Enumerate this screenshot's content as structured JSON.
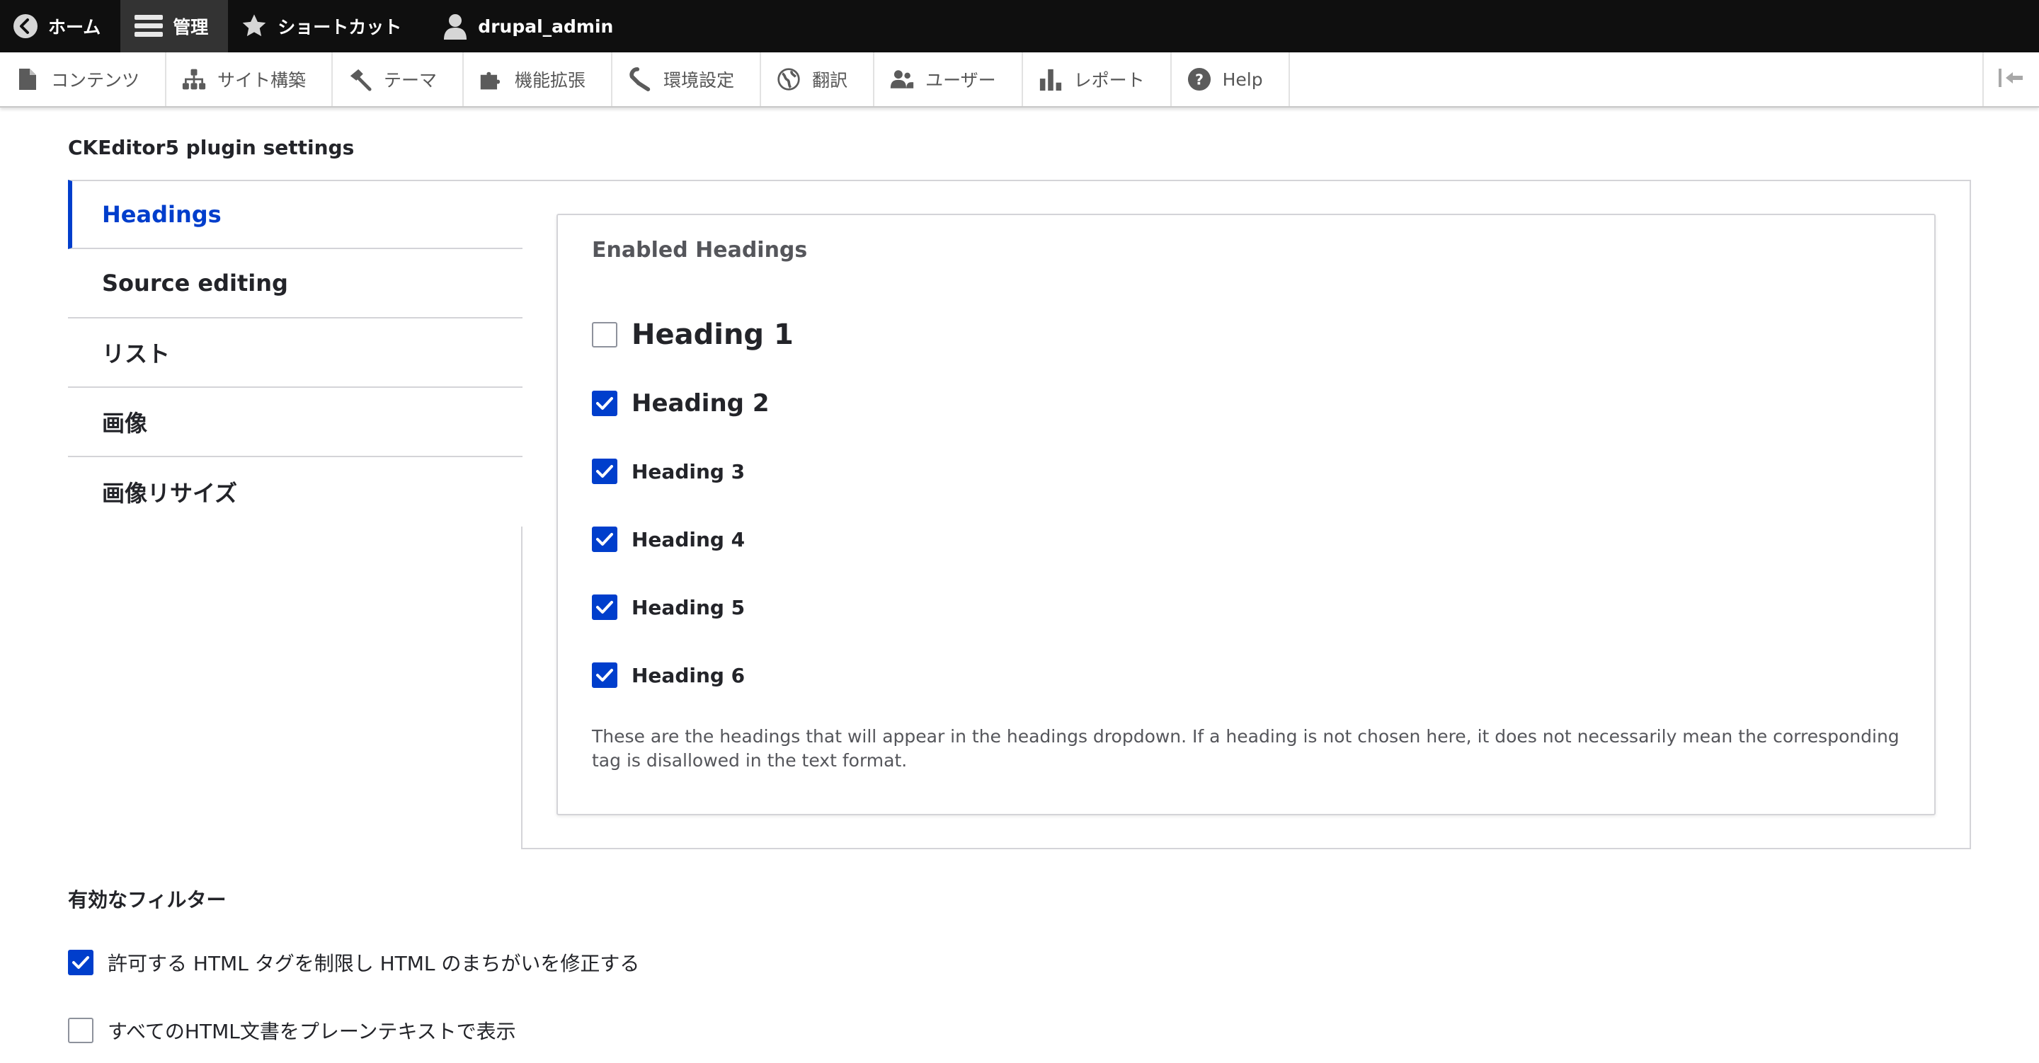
{
  "toolbar": {
    "home": "ホーム",
    "manage": "管理",
    "shortcuts": "ショートカット",
    "user": "drupal_admin"
  },
  "tray": {
    "items": [
      {
        "label": "コンテンツ",
        "icon": "file-icon"
      },
      {
        "label": "サイト構築",
        "icon": "sitemap-icon"
      },
      {
        "label": "テーマ",
        "icon": "paintbrush-icon"
      },
      {
        "label": "機能拡張",
        "icon": "puzzle-icon"
      },
      {
        "label": "環境設定",
        "icon": "wrench-icon"
      },
      {
        "label": "翻訳",
        "icon": "globe-icon"
      },
      {
        "label": "ユーザー",
        "icon": "people-icon"
      },
      {
        "label": "レポート",
        "icon": "bar-chart-icon"
      },
      {
        "label": "Help",
        "icon": "help-icon"
      }
    ]
  },
  "plugin_settings": {
    "title": "CKEditor5 plugin settings",
    "tabs": [
      "Headings",
      "Source editing",
      "リスト",
      "画像",
      "画像リサイズ"
    ],
    "active_tab": "Headings",
    "enabled_headings": {
      "legend": "Enabled Headings",
      "options": [
        {
          "label": "Heading 1",
          "checked": false
        },
        {
          "label": "Heading 2",
          "checked": true
        },
        {
          "label": "Heading 3",
          "checked": true
        },
        {
          "label": "Heading 4",
          "checked": true
        },
        {
          "label": "Heading 5",
          "checked": true
        },
        {
          "label": "Heading 6",
          "checked": true
        }
      ],
      "description": "These are the headings that will appear in the headings dropdown. If a heading is not chosen here, it does not necessarily mean the corresponding tag is disallowed in the text format."
    }
  },
  "filters": {
    "title": "有効なフィルター",
    "items": [
      {
        "label": "許可する HTML タグを制限し HTML のまちがいを修正する",
        "checked": true
      },
      {
        "label": "すべてのHTML文書をプレーンテキストで表示",
        "checked": false
      }
    ]
  },
  "colors": {
    "accent": "#003ecc",
    "toolbar_bg": "#0f0f0f",
    "text": "#232429",
    "muted": "#55565b"
  }
}
